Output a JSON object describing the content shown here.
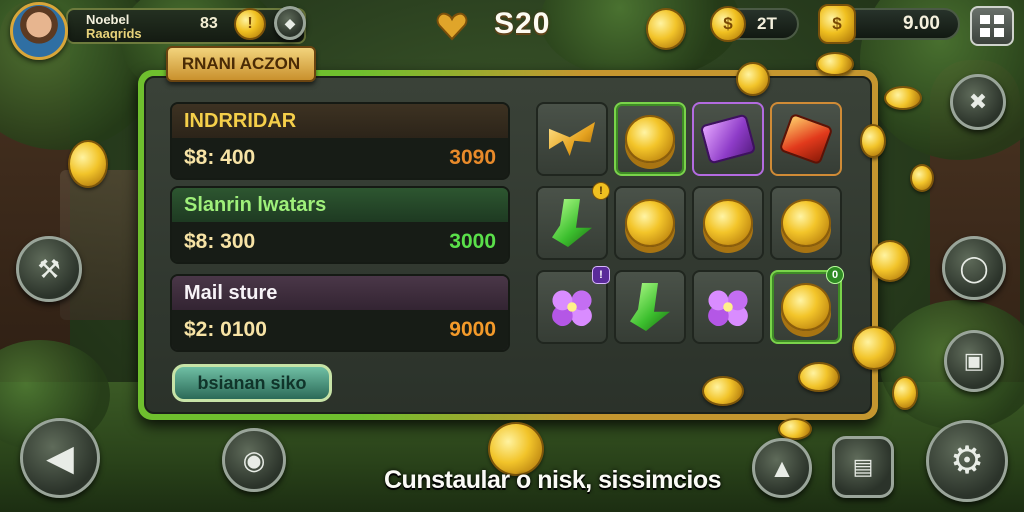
{
  "hud": {
    "player_name": "Noebel",
    "player_subtitle": "Raaqrids",
    "player_count": "83",
    "currency_value": "S20",
    "count_secondary": "2T",
    "count_tertiary": "9.00"
  },
  "panel": {
    "tab_title": "RNANI ACZON",
    "items": [
      {
        "name": "INDRRIDAR",
        "price": "$8: 400",
        "alt_price": "3090"
      },
      {
        "name": "Slanrin lwatars",
        "price": "$8: 300",
        "alt_price": "3000"
      },
      {
        "name": "Mail sture",
        "price": "$2: 0100",
        "alt_price": "9000"
      }
    ],
    "action_button": "bsianan siko",
    "grid_badges": [
      "!",
      "!",
      "!",
      "0"
    ]
  },
  "subtitle": "Cunstaular o nisk, sissimcios",
  "colors": {
    "accent_green": "#6fbf2e",
    "accent_gold": "#f0c020",
    "accent_purple": "#b36be0"
  },
  "icons": {
    "hud_left": [
      "player-avatar-icon",
      "gold-coin-icon",
      "gem-icon"
    ],
    "hud_center": "heart-icon",
    "hud_right": [
      "gold-coin-icon",
      "shield-coin-icon",
      "menu-grid-icon"
    ],
    "side_left": [
      "hammer-icon",
      "back-arrow-icon",
      "camera-icon"
    ],
    "side_right": [
      "wrench-icon",
      "ring-icon",
      "phone-icon",
      "settings-gear-icon",
      "delete-icon",
      "up-arrow-icon"
    ]
  }
}
